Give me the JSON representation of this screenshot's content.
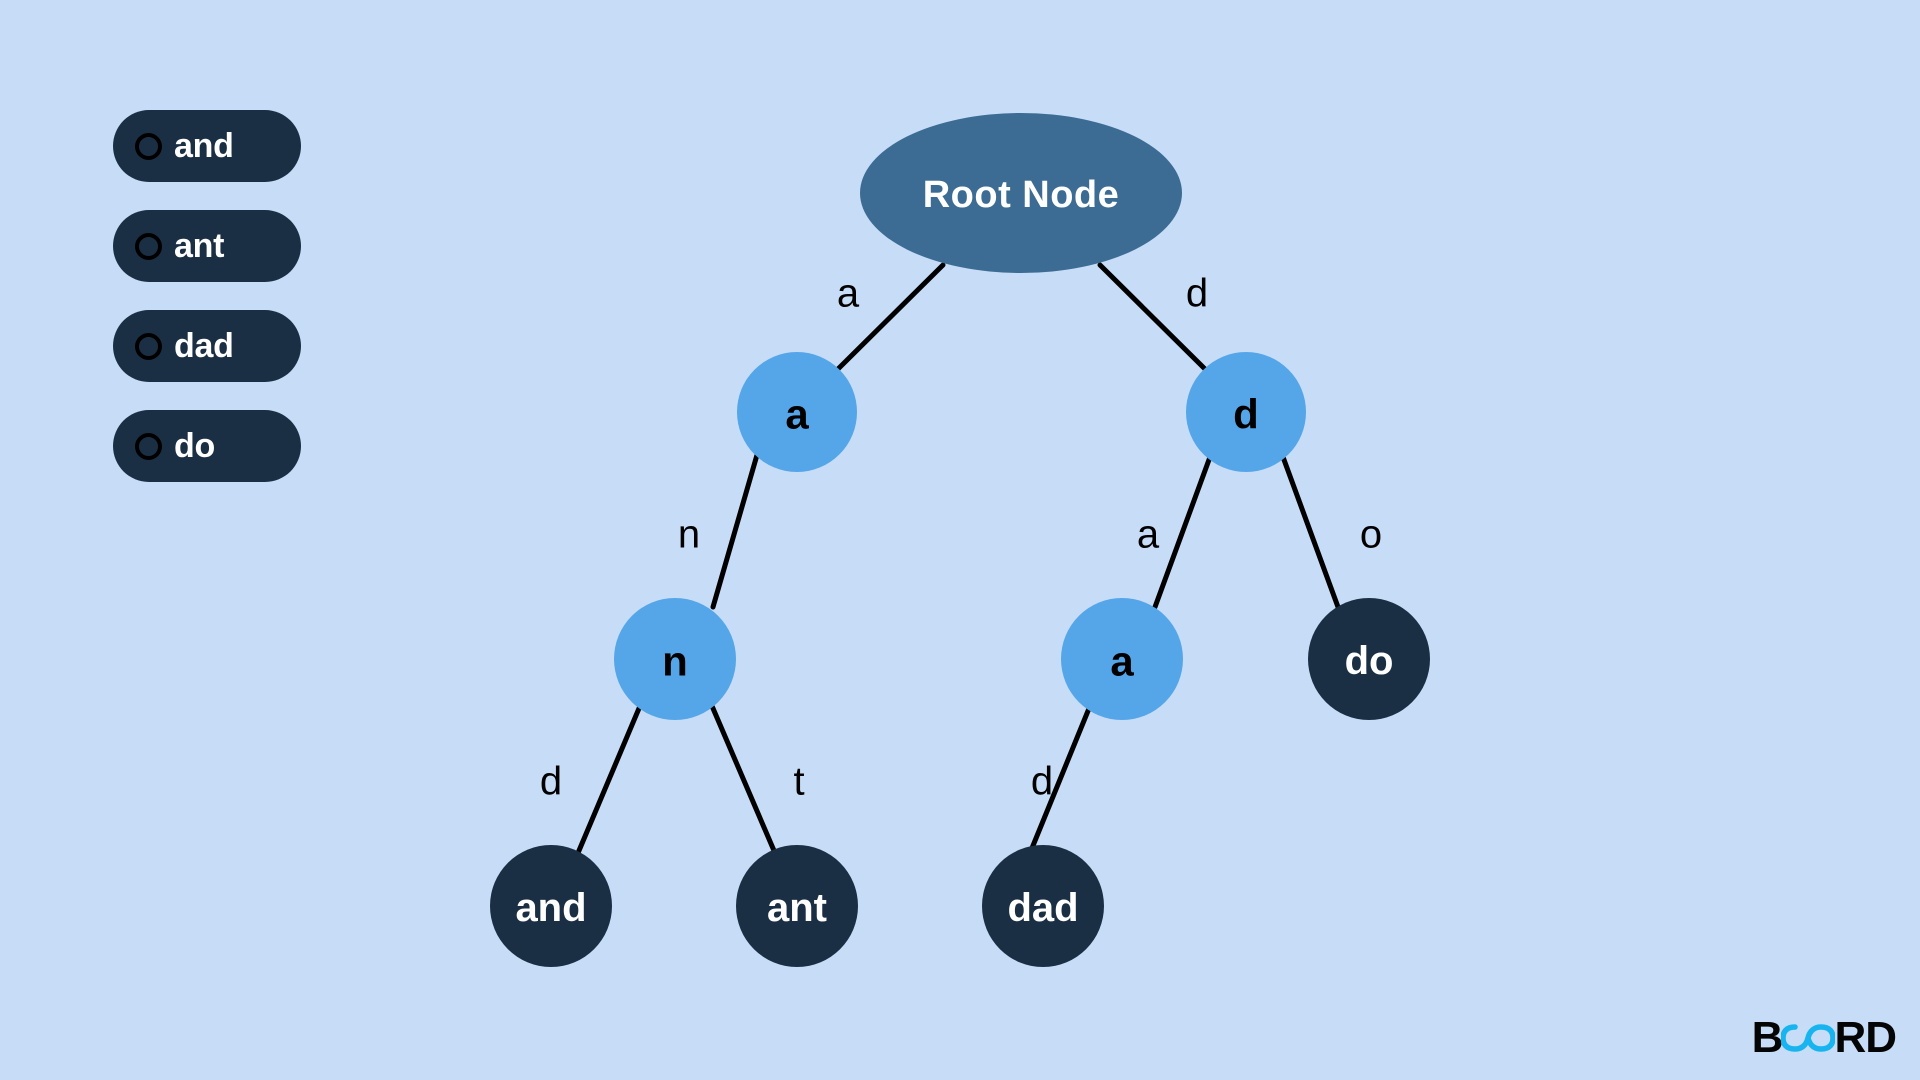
{
  "background_color": "#c7dcf7",
  "colors": {
    "background": "#c7dcf7",
    "pill": "#1b2f44",
    "root_node": "#3c6c93",
    "internal_node": "#55a6e8",
    "word_node": "#1b2f44",
    "edge": "#000000",
    "logo_accent": "#17b4ef"
  },
  "word_list": {
    "items": [
      {
        "label": "and",
        "bullet": "radio-circle-icon"
      },
      {
        "label": "ant",
        "bullet": "radio-circle-icon"
      },
      {
        "label": "dad",
        "bullet": "radio-circle-icon"
      },
      {
        "label": "do",
        "bullet": "radio-circle-icon"
      }
    ]
  },
  "tree": {
    "root": {
      "label": "Root Node"
    },
    "nodes": [
      {
        "id": "a1",
        "label": "a",
        "kind": "internal"
      },
      {
        "id": "d1",
        "label": "d",
        "kind": "internal"
      },
      {
        "id": "n1",
        "label": "n",
        "kind": "internal"
      },
      {
        "id": "a2",
        "label": "a",
        "kind": "internal"
      },
      {
        "id": "do",
        "label": "do",
        "kind": "word"
      },
      {
        "id": "and",
        "label": "and",
        "kind": "word"
      },
      {
        "id": "ant",
        "label": "ant",
        "kind": "word"
      },
      {
        "id": "dad",
        "label": "dad",
        "kind": "word"
      }
    ],
    "edge_labels": [
      {
        "id": "root-a",
        "label": "a"
      },
      {
        "id": "root-d",
        "label": "d"
      },
      {
        "id": "a-n",
        "label": "n"
      },
      {
        "id": "d-a",
        "label": "a"
      },
      {
        "id": "d-o",
        "label": "o"
      },
      {
        "id": "n-d",
        "label": "d"
      },
      {
        "id": "n-t",
        "label": "t"
      },
      {
        "id": "a-d",
        "label": "d"
      }
    ]
  },
  "logo": {
    "prefix": "B",
    "accent": "∞",
    "suffix": "RD",
    "full": "BOARD"
  }
}
